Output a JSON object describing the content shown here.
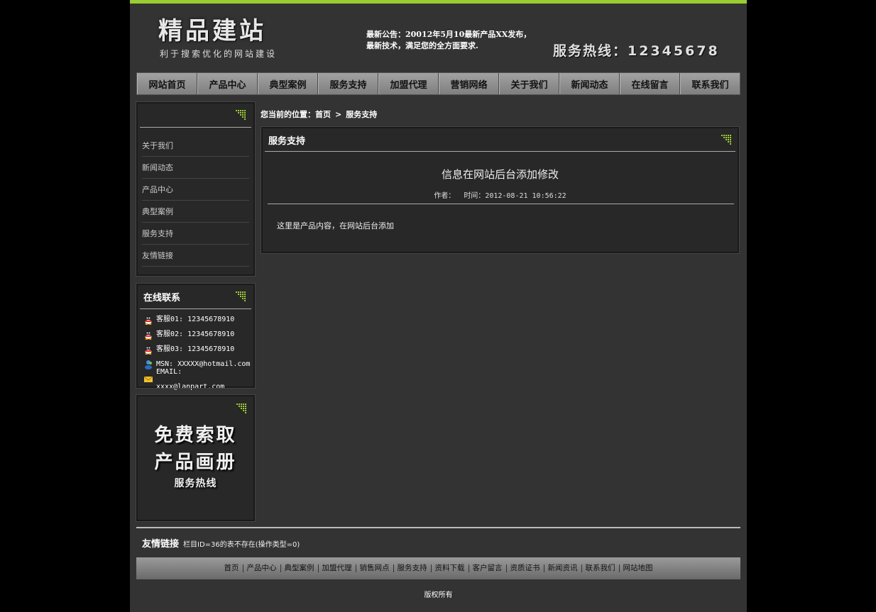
{
  "header": {
    "logo_title": "精品建站",
    "logo_subtitle": "利于搜索优化的网站建设",
    "notice_line1": "最新公告：20012年5月10最新产品XX发布，",
    "notice_line2": "最新技术，满足您的全方面要求.",
    "hotline_label": "服务热线：",
    "hotline_number": "12345678"
  },
  "nav": {
    "items": [
      "网站首页",
      "产品中心",
      "典型案例",
      "服务支持",
      "加盟代理",
      "营销网络",
      "关于我们",
      "新闻动态",
      "在线留言",
      "联系我们"
    ]
  },
  "sidebar": {
    "menu_title": "",
    "menu_items": [
      "关于我们",
      "新闻动态",
      "产品中心",
      "典型案例",
      "服务支持",
      "友情链接"
    ],
    "contact_title": "在线联系",
    "contacts": [
      {
        "icon": "qq-icon",
        "text": "客服01: 12345678910"
      },
      {
        "icon": "qq-icon",
        "text": "客服02: 12345678910"
      },
      {
        "icon": "qq-icon",
        "text": "客服03: 12345678910"
      },
      {
        "icon": "msn-icon",
        "text": "MSN: XXXXX@hotmail.com"
      },
      {
        "icon": "mail-icon",
        "text": "EMAIL: xxxx@lanpart.com"
      }
    ],
    "promo_line1": "免费索取",
    "promo_line2": "产品画册",
    "promo_line3": "服务热线"
  },
  "breadcrumb": {
    "prefix": "您当前的位置：",
    "home": "首页",
    "separator": ">",
    "current": "服务支持"
  },
  "main": {
    "box_title": "服务支持",
    "article_title": "信息在网站后台添加修改",
    "author_label": "作者：",
    "time_label": "时间：",
    "time_value": "2012-08-21 10:56:22",
    "body": "这里是产品内容，在网站后台添加"
  },
  "footer": {
    "friend_links_title": "友情链接",
    "friend_links_text": "栏目ID=36的表不存在(操作类型=0)",
    "nav_items": [
      "首页",
      "产品中心",
      "典型案例",
      "加盟代理",
      "销售网点",
      "服务支持",
      "资料下载",
      "客户留言",
      "资质证书",
      "新闻资讯",
      "联系我们",
      "网站地图"
    ],
    "copyright": "版权所有"
  },
  "colors": {
    "accent": "#9acd32",
    "background": "#333333",
    "panel": "#282828"
  }
}
